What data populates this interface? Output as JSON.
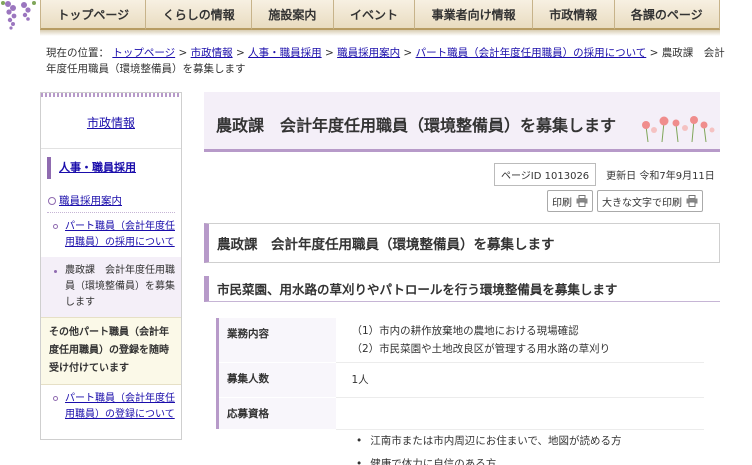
{
  "nav": {
    "items": [
      "トップページ",
      "くらしの情報",
      "施設案内",
      "イベント",
      "事業者向け情報",
      "市政情報",
      "各課のページ"
    ]
  },
  "breadcrumb": {
    "prefix": "現在の位置：",
    "links": [
      "トップページ",
      "市政情報",
      "人事・職員採用",
      "職員採用案内",
      "パート職員（会計年度任用職員）の採用について"
    ],
    "sep": " > ",
    "current": "農政課　会計年度任用職員（環境整備員）を募集します"
  },
  "sidebar": {
    "title": "市政情報",
    "level1": "人事・職員採用",
    "level2": "職員採用案内",
    "items": [
      {
        "label": "パート職員（会計年度任用職員）の採用について",
        "current": false
      },
      {
        "label": "農政課　会計年度任用職員（環境整備員）を募集します",
        "current": true
      }
    ],
    "section_title": "その他パート職員（会計年度任用職員）の登録を随時受け付けています",
    "section_items": [
      "パート職員（会計年度任用職員）の登録について"
    ]
  },
  "page": {
    "title": "農政課　会計年度任用職員（環境整備員）を募集します",
    "page_id": "ページID 1013026",
    "updated": "更新日 令和7年9月11日",
    "print_label": "印刷",
    "large_print_label": "大きな文字で印刷",
    "heading2": "農政課　会計年度任用職員（環境整備員）を募集します",
    "heading3": "市民菜園、用水路の草刈りやパトロールを行う環境整備員を募集します",
    "table": {
      "duties_label": "業務内容",
      "duties": [
        "（1）市内の耕作放棄地の農地における現場確認",
        "（2）市民菜園や土地改良区が管理する用水路の草刈り"
      ],
      "count_label": "募集人数",
      "count": "1人",
      "qualifications_label": "応募資格"
    },
    "qualifications": [
      "江南市または市内周辺にお住まいで、地図が読める方",
      "健康で体力に自信のある方"
    ]
  },
  "colors": {
    "accent": "#b79ac9",
    "title_bg": "#f4eff8",
    "nav_bg": "#e9dcc0",
    "link": "#1a0dab"
  }
}
